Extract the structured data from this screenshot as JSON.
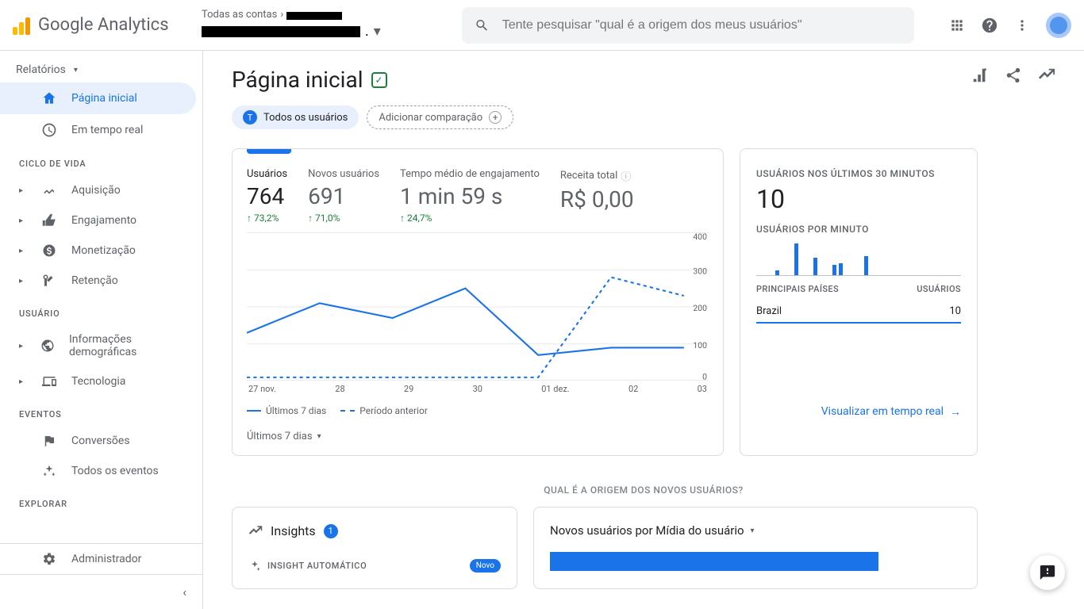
{
  "header": {
    "product_name": "Google Analytics",
    "all_accounts_label": "Todas as contas",
    "search_placeholder": "Tente pesquisar \"qual é a origem dos meus usuários\""
  },
  "sidebar": {
    "reports_label": "Relatórios",
    "items_top": [
      {
        "label": "Página inicial"
      },
      {
        "label": "Em tempo real"
      }
    ],
    "section_lifecycle": "CICLO DE VIDA",
    "items_lifecycle": [
      {
        "label": "Aquisição"
      },
      {
        "label": "Engajamento"
      },
      {
        "label": "Monetização"
      },
      {
        "label": "Retenção"
      }
    ],
    "section_user": "USUÁRIO",
    "items_user": [
      {
        "label": "Informações demográficas"
      },
      {
        "label": "Tecnologia"
      }
    ],
    "section_events": "EVENTOS",
    "items_events": [
      {
        "label": "Conversões"
      },
      {
        "label": "Todos os eventos"
      }
    ],
    "section_explore": "EXPLORAR",
    "admin_label": "Administrador"
  },
  "page": {
    "title": "Página inicial",
    "chip_all_users": "Todos os usuários",
    "chip_add_compare": "Adicionar comparação"
  },
  "metrics": {
    "items": [
      {
        "label": "Usuários",
        "value": "764",
        "delta": "↑ 73,2%"
      },
      {
        "label": "Novos usuários",
        "value": "691",
        "delta": "↑ 71,0%"
      },
      {
        "label": "Tempo médio de engajamento",
        "value": "1 min 59 s",
        "delta": "↑ 24,7%"
      },
      {
        "label": "Receita total",
        "value": "R$ 0,00",
        "delta": ""
      }
    ],
    "legend_current": "Últimos 7 dias",
    "legend_previous": "Período anterior",
    "period_selector": "Últimos 7 dias"
  },
  "realtime": {
    "title": "USUÁRIOS NOS ÚLTIMOS 30 MINUTOS",
    "big_value": "10",
    "per_minute_label": "USUÁRIOS POR MINUTO",
    "col_country": "PRINCIPAIS PAÍSES",
    "col_users": "USUÁRIOS",
    "rows": [
      {
        "country": "Brazil",
        "users": "10"
      }
    ],
    "link_label": "Visualizar em tempo real"
  },
  "section_question": "QUAL É A ORIGEM DOS NOVOS USUÁRIOS?",
  "insights": {
    "title": "Insights",
    "badge": "1",
    "auto_label": "INSIGHT AUTOMÁTICO",
    "new_chip": "Novo"
  },
  "source_card": {
    "title": "Novos usuários por Mídia do usuário"
  },
  "chart_data": {
    "type": "line",
    "title": "Usuários — Últimos 7 dias",
    "xlabel": "",
    "ylabel": "",
    "ylim": [
      0,
      400
    ],
    "yticks": [
      0,
      100,
      200,
      300,
      400
    ],
    "categories": [
      "27 nov.",
      "28",
      "29",
      "30",
      "01 dez.",
      "02",
      "03"
    ],
    "series": [
      {
        "name": "Últimos 7 dias",
        "values": [
          130,
          210,
          170,
          250,
          70,
          90,
          90
        ]
      },
      {
        "name": "Período anterior",
        "values": [
          10,
          10,
          10,
          10,
          10,
          280,
          230
        ]
      }
    ],
    "realtime_bars": [
      0,
      0,
      0,
      7,
      0,
      0,
      44,
      0,
      0,
      24,
      0,
      0,
      14,
      16,
      0,
      0,
      0,
      26,
      0,
      0,
      0,
      0,
      0,
      0,
      0,
      0,
      0,
      0,
      0,
      0
    ]
  }
}
